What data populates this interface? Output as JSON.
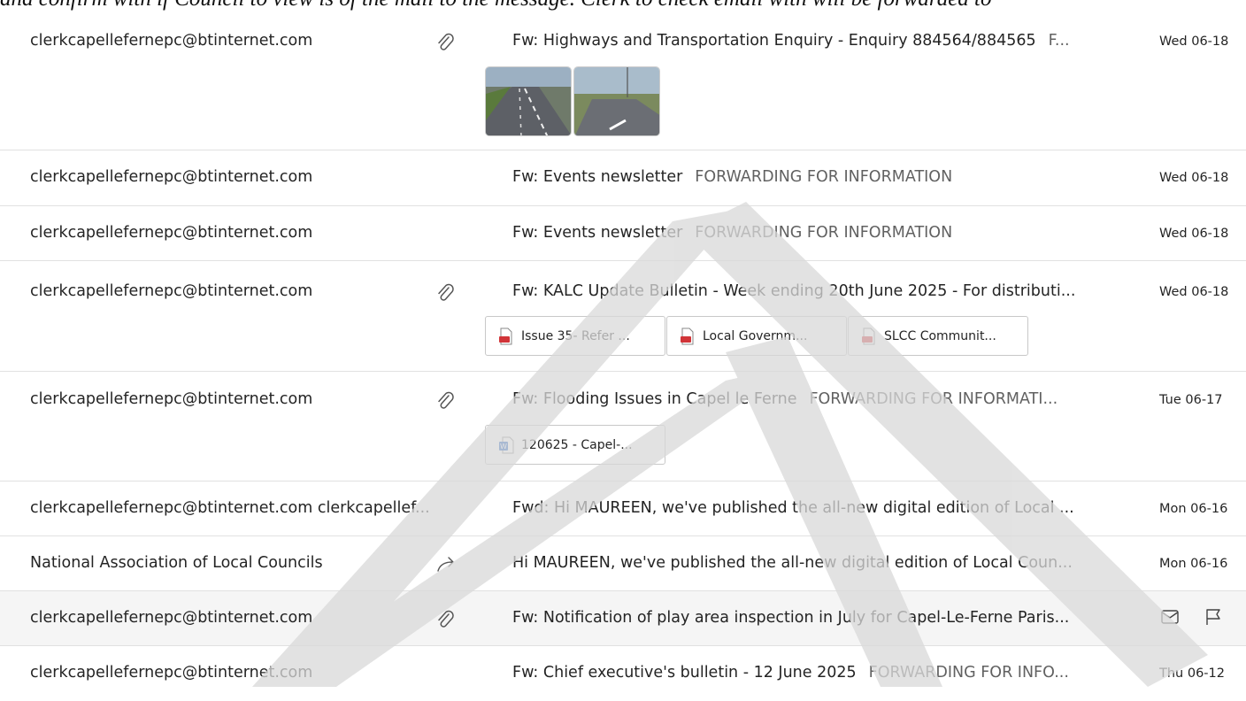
{
  "top_partial_text": "and confirm with if Council to view is of the mail to the message. Clerk to check email with will be forwarded to",
  "messages": [
    {
      "sender": "clerkcapellefernepc@btinternet.com",
      "subject": "Fw: Highways and Transportation Enquiry - Enquiry 884564/884565",
      "preview": "F...",
      "date": "Wed 06-18",
      "icon": "paperclip-icon"
    },
    {
      "sender": "clerkcapellefernepc@btinternet.com",
      "subject": "Fw: Events newsletter",
      "preview": "FORWARDING FOR INFORMATION",
      "date": "Wed 06-18"
    },
    {
      "sender": "clerkcapellefernepc@btinternet.com",
      "subject": "Fw: Events newsletter",
      "preview": "FORWARDING FOR INFORMATION",
      "date": "Wed 06-18"
    },
    {
      "sender": "clerkcapellefernepc@btinternet.com",
      "subject": "Fw: KALC Update Bulletin - Week ending 20th June 2025 - For distributi...",
      "preview": "",
      "date": "Wed 06-18",
      "icon": "paperclip-icon",
      "attachments": [
        {
          "name": "Issue 35- Refer ...",
          "icon": "pdf-icon"
        },
        {
          "name": "Local Governm...",
          "icon": "pdf-icon"
        },
        {
          "name": "SLCC Communit...",
          "icon": "pdf-icon"
        }
      ]
    },
    {
      "sender": "clerkcapellefernepc@btinternet.com",
      "subject": "Fw: Flooding Issues in Capel le Ferne",
      "preview": "FORWARDING FOR INFORMATI...",
      "date": "Tue 06-17",
      "icon": "paperclip-icon",
      "attachments": [
        {
          "name": "120625 - Capel-...",
          "icon": "word-icon"
        }
      ]
    },
    {
      "sender": "clerkcapellefernepc@btinternet.com clerkcapellef...",
      "subject": "Fwd: Hi MAUREEN, we've published the all-new digital edition of Local ...",
      "preview": "",
      "date": "Mon 06-16"
    },
    {
      "sender": "National Association of Local Councils",
      "subject": "Hi MAUREEN, we've published the all-new digital edition of Local Coun...",
      "preview": "",
      "date": "Mon 06-16",
      "icon": "forward-arrow-icon"
    },
    {
      "sender": "clerkcapellefernepc@btinternet.com",
      "subject": "Fw: Notification of play area inspection in July for Capel-Le-Ferne Paris...",
      "preview": "",
      "date": "",
      "icon": "paperclip-icon",
      "hover_actions": [
        "envelope-icon",
        "flag-icon"
      ]
    },
    {
      "sender": "clerkcapellefernepc@btinternet.com",
      "subject": "Fw: Chief executive's bulletin - 12 June 2025",
      "preview": "FORWARDING FOR INFO...",
      "date": "Thu 06-12"
    }
  ],
  "colors": {
    "divider": "#e1e1e1",
    "highlight_row": "#f5f5f5",
    "watermark": "#e3e3e3",
    "text": "#242424",
    "preview": "#616161"
  }
}
